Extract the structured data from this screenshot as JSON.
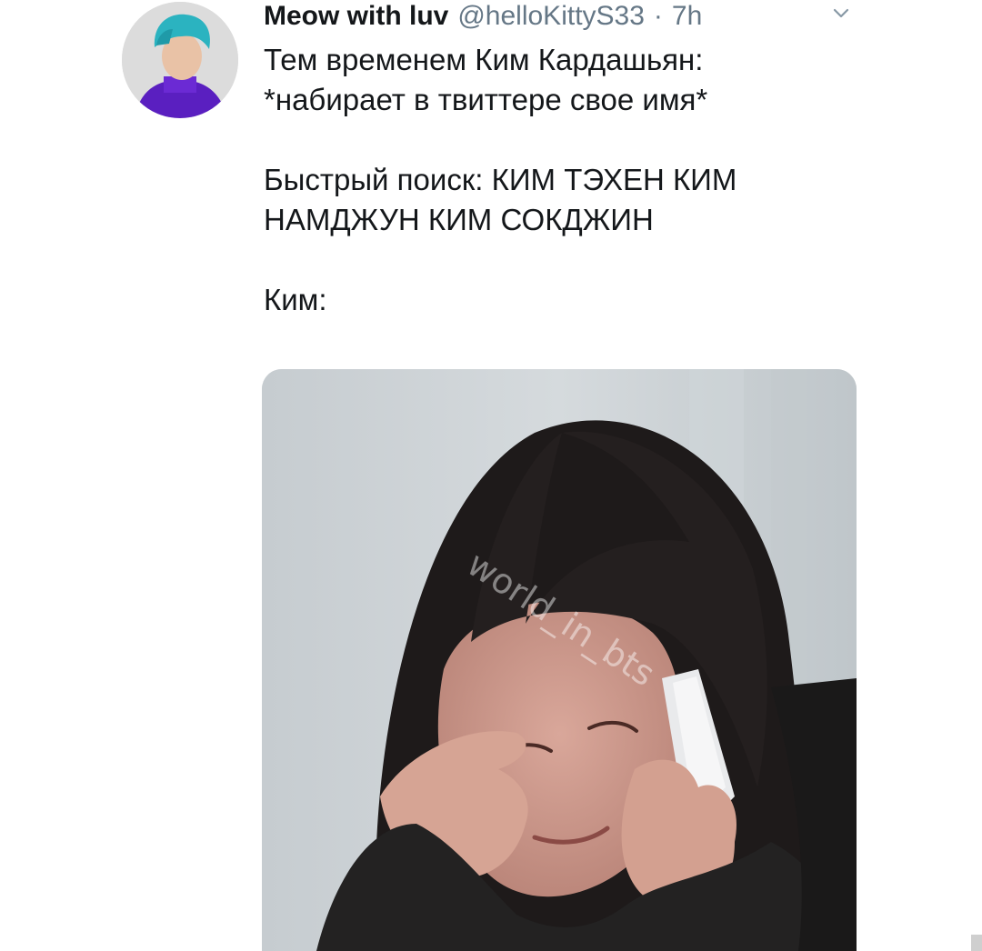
{
  "tweet": {
    "display_name": "Meow with luv",
    "handle": "@helloKittyS33",
    "separator": "·",
    "time": "7h",
    "lines": [
      "Тем временем Ким Кардашьян:",
      "*набирает в твиттере свое имя*",
      "",
      "Быстрый поиск: КИМ ТЭХЕН КИМ",
      "НАМДЖУН КИМ СОКДЖИН",
      "",
      "Ким:"
    ],
    "avatar_icon": "profile-avatar",
    "menu_icon": "chevron-down-icon"
  },
  "media": {
    "watermark": "world_in_bts",
    "description_icon": "crying-woman-photo"
  },
  "colors": {
    "text": "#14171a",
    "secondary": "#657786",
    "background": "#ffffff"
  }
}
